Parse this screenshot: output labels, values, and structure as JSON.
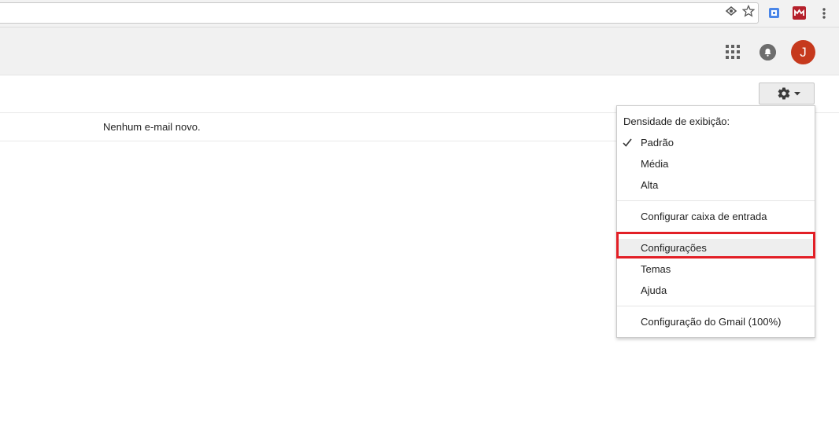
{
  "header": {
    "avatar_initial": "J"
  },
  "main": {
    "empty_message": "Nenhum e-mail novo."
  },
  "settings_menu": {
    "density_heading": "Densidade de exibição:",
    "density_options": [
      {
        "label": "Padrão",
        "checked": true
      },
      {
        "label": "Média",
        "checked": false
      },
      {
        "label": "Alta",
        "checked": false
      }
    ],
    "configure_inbox": "Configurar caixa de entrada",
    "settings": "Configurações",
    "themes": "Temas",
    "help": "Ajuda",
    "gmail_config": "Configuração do Gmail (100%)"
  },
  "colors": {
    "avatar_bg": "#c6391d",
    "highlight_border": "#e21f26"
  },
  "icons": [
    "eye-icon",
    "star-icon",
    "extension-icon-1",
    "extension-icon-2",
    "more-vert-icon",
    "apps-grid-icon",
    "notifications-icon",
    "gear-icon",
    "caret-down-icon",
    "checkmark-icon"
  ]
}
